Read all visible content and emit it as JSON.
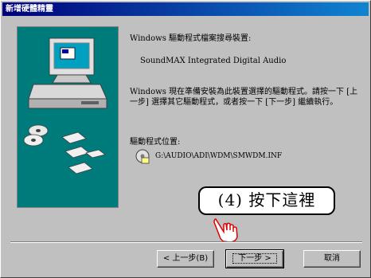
{
  "window": {
    "title": "新增硬體精靈"
  },
  "content": {
    "heading": "Windows 驅動程式檔案搜尋裝置:",
    "device_name": "SoundMAX Integrated Digital Audio",
    "instructions": "Windows 現在準備安裝為此裝置選擇的驅動程式。請按一下 [上一步] 選擇其它驅動程式，或者按一下 [下一步] 繼續執行。",
    "location_label": "驅動程式位置:",
    "location_path": "G:\\AUDIO\\ADI\\WDM\\SMWDM.INF"
  },
  "buttons": {
    "back": "< 上一步(B)",
    "next": "下一步 >",
    "cancel": "取消"
  },
  "annotation": {
    "callout_text": "(4) 按下這裡"
  },
  "colors": {
    "titlebar": "#00007b",
    "illustration_bg": "#007b7b",
    "face": "#c0c0c0"
  }
}
